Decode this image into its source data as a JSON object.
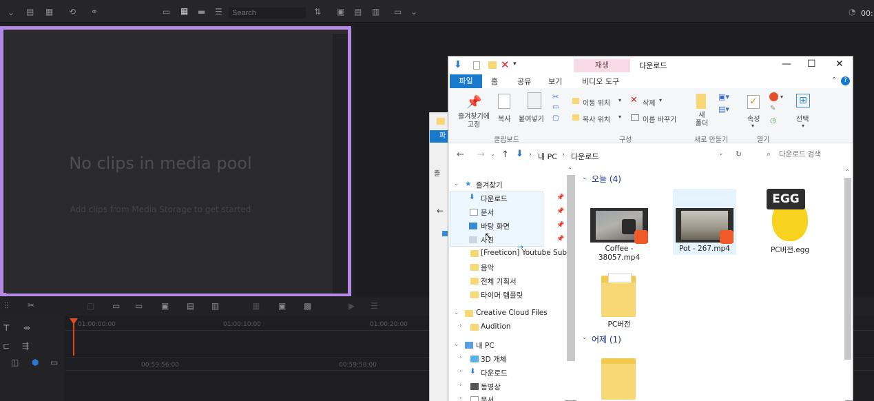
{
  "davinci": {
    "search_placeholder": "Search",
    "timecode": "00:",
    "empty_title": "No clips in media pool",
    "empty_hint": "Add clips from Media Storage to get started",
    "ruler_times": [
      "01:00:00:00",
      "01:00:10:00",
      "01:00:20:00"
    ],
    "ruler2_times": [
      "00:59:56:00",
      "00:59:58:00"
    ]
  },
  "explorer": {
    "title": "다운로드",
    "contextual_tab": "재생",
    "tabs": [
      "파일",
      "홈",
      "공유",
      "보기",
      "비디오 도구"
    ],
    "ribbon": {
      "pin_label": "즐겨찾기에\n고정",
      "copy_label": "복사",
      "paste_label": "붙여넣기",
      "move_to": "이동 위치",
      "delete": "삭제",
      "copy_to": "복사 위치",
      "rename": "이름 바꾸기",
      "new_folder": "새\n폴더",
      "properties": "속성",
      "select": "선택",
      "group_clipboard": "클립보드",
      "group_organize": "구성",
      "group_new": "새로 만들기",
      "group_open": "열기"
    },
    "address": [
      "내 PC",
      "다운로드"
    ],
    "search_placeholder": "다운로드 검색",
    "nav": {
      "quick_access": "즐겨찾기",
      "items": [
        "다운로드",
        "문서",
        "바탕 화면",
        "사진",
        "[Freeticon] Youtube Subsc",
        "음악",
        "전체 기획서",
        "타이머 템플릿"
      ],
      "creative_cloud": "Creative Cloud Files",
      "audition": "Audition",
      "this_pc": "내 PC",
      "pc_items": [
        "3D 개체",
        "다운로드",
        "동영상",
        "문서"
      ]
    },
    "groups": {
      "today": "오늘 (4)",
      "yesterday": "어제 (1)"
    },
    "files": [
      {
        "name": "Coffee -\n38057.mp4"
      },
      {
        "name": "Pot - 267.mp4"
      },
      {
        "name": "PC버전.egg",
        "badge": "EGG"
      },
      {
        "name": "PC버전"
      }
    ]
  },
  "back_window": {
    "tab": "파",
    "label": "즐"
  }
}
